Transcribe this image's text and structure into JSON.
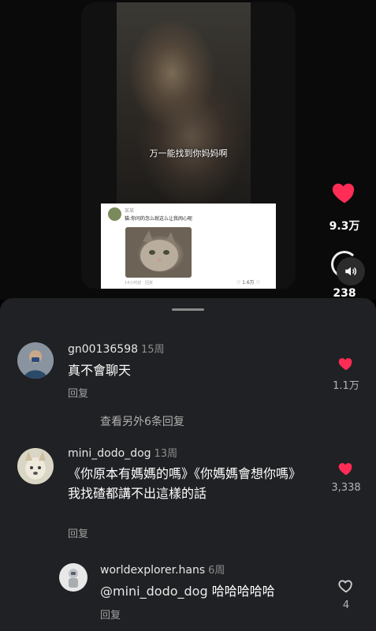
{
  "video": {
    "subtitle": "万一能找到你妈妈啊",
    "inner_post": {
      "name": "某某",
      "text": "猫:你问的怎么就这么让我闹心呢",
      "meta": "14小时前 · 回复",
      "likes": "1.6万"
    }
  },
  "actions": {
    "like_count": "9.3万",
    "save_count": "238",
    "like_color": "#ff2c55"
  },
  "comments": [
    {
      "username": "gn00136598",
      "time": "15周",
      "text": "真不會聊天",
      "reply_label": "回复",
      "likes": "1.1万",
      "liked": true
    },
    {
      "more_replies": "查看另外6条回复"
    },
    {
      "username": "mini_dodo_dog",
      "time": "13周",
      "text": "《你原本有媽媽的嗎》《你媽媽會想你嗎》",
      "text2": "我找碴都講不出這樣的話",
      "reply_label": "回复",
      "likes": "3,338",
      "liked": true
    },
    {
      "username": "worldexplorer.hans",
      "time": "6周",
      "mention": "@mini_dodo_dog",
      "text": " 哈哈哈哈哈",
      "reply_label": "回复",
      "likes": "4",
      "liked": false
    }
  ]
}
